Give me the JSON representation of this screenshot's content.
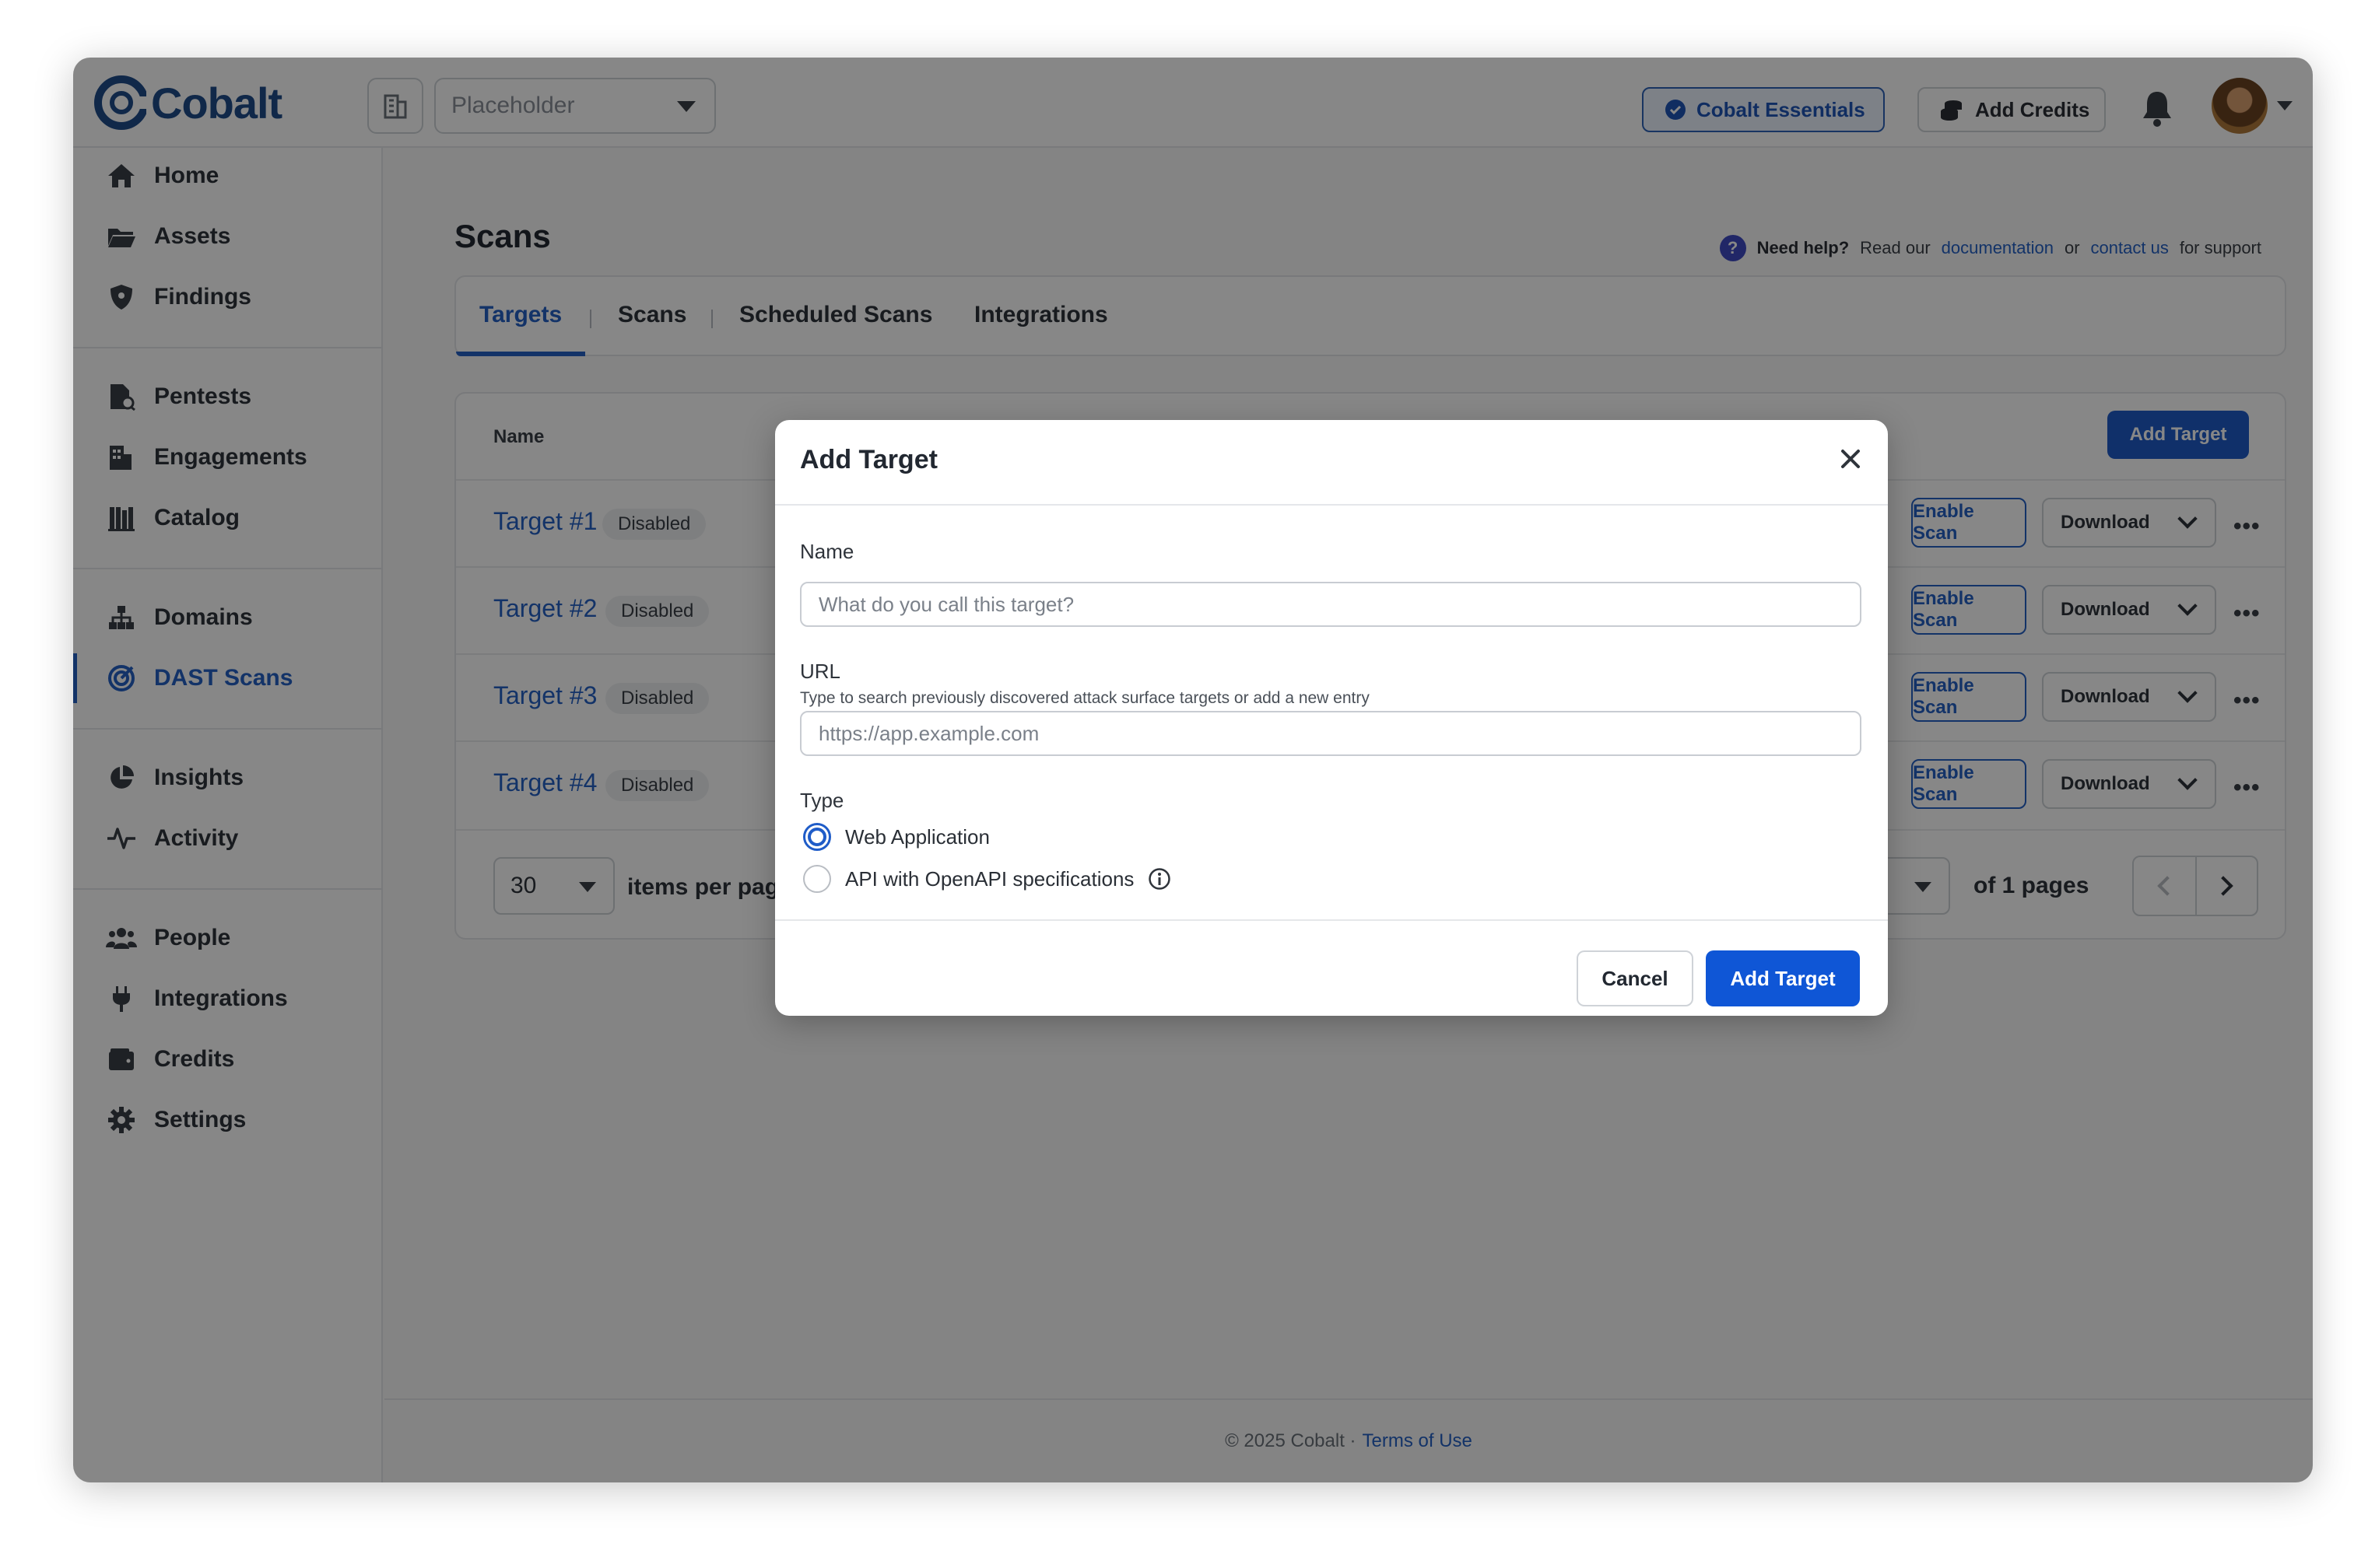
{
  "brand": {
    "name": "Cobalt"
  },
  "header": {
    "org_placeholder": "Placeholder",
    "plan_label": "Cobalt Essentials",
    "credits_label": "Add Credits"
  },
  "sidebar": {
    "items": [
      {
        "label": "Home",
        "icon": "home-icon"
      },
      {
        "label": "Assets",
        "icon": "folder-icon"
      },
      {
        "label": "Findings",
        "icon": "shield-icon"
      },
      {
        "label": "Pentests",
        "icon": "pentest-icon"
      },
      {
        "label": "Engagements",
        "icon": "building-icon"
      },
      {
        "label": "Catalog",
        "icon": "catalog-icon"
      },
      {
        "label": "Domains",
        "icon": "sitemap-icon"
      },
      {
        "label": "DAST Scans",
        "icon": "target-icon",
        "active": true
      },
      {
        "label": "Insights",
        "icon": "pie-chart-icon"
      },
      {
        "label": "Activity",
        "icon": "pulse-icon"
      },
      {
        "label": "People",
        "icon": "users-icon"
      },
      {
        "label": "Integrations",
        "icon": "plug-icon"
      },
      {
        "label": "Credits",
        "icon": "wallet-icon"
      },
      {
        "label": "Settings",
        "icon": "gear-icon"
      }
    ]
  },
  "page": {
    "title": "Scans",
    "help": {
      "need_help": "Need help?",
      "read_our": "Read our",
      "documentation": "documentation",
      "or": "or",
      "contact_us": "contact us",
      "for_support": "for support"
    },
    "tabs": [
      {
        "label": "Targets",
        "active": true
      },
      {
        "label": "Scans"
      },
      {
        "label": "Scheduled Scans"
      },
      {
        "label": "Integrations"
      }
    ]
  },
  "table": {
    "column_name": "Name",
    "add_target_label": "Add Target",
    "rows": [
      {
        "name": "Target #1",
        "status": "Disabled",
        "enable_label": "Enable Scan",
        "download_label": "Download"
      },
      {
        "name": "Target #2",
        "status": "Disabled",
        "enable_label": "Enable Scan",
        "download_label": "Download"
      },
      {
        "name": "Target #3",
        "status": "Disabled",
        "enable_label": "Enable Scan",
        "download_label": "Download"
      },
      {
        "name": "Target #4",
        "status": "Disabled",
        "enable_label": "Enable Scan",
        "download_label": "Download"
      }
    ],
    "more_label": "•••",
    "pagination": {
      "per_page": "30",
      "per_page_label": "items per page",
      "of_pages": "of 1 pages"
    }
  },
  "footer": {
    "copyright": "© 2025 Cobalt ·",
    "terms": "Terms of Use"
  },
  "modal": {
    "title": "Add Target",
    "name_label": "Name",
    "name_placeholder": "What do you call this target?",
    "url_label": "URL",
    "url_help": "Type to search previously discovered attack surface targets or add a new entry",
    "url_placeholder": "https://app.example.com",
    "type_label": "Type",
    "types": [
      {
        "label": "Web Application",
        "selected": true
      },
      {
        "label": "API with OpenAPI specifications",
        "selected": false
      }
    ],
    "cancel_label": "Cancel",
    "submit_label": "Add Target"
  },
  "colors": {
    "accent": "#2560c4",
    "primary_button": "#0f56d6",
    "overlay": "rgba(0,0,0,0.47)"
  }
}
